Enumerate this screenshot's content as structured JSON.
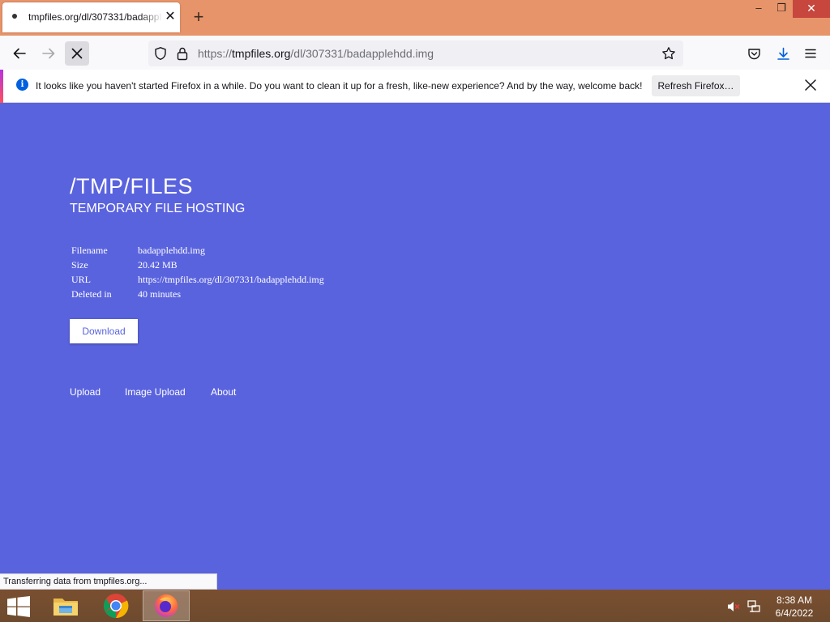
{
  "browser": {
    "tab": {
      "title": "tmpfiles.org/dl/307331/badapplehdd.img",
      "close_glyph": "✕"
    },
    "new_tab_glyph": "+",
    "window_controls": {
      "minimize": "–",
      "maximize": "❐",
      "close": "✕"
    },
    "url": {
      "prefix": "https://",
      "host": "tmpfiles.org",
      "path": "/dl/307331/badapplehdd.img"
    },
    "notification": {
      "message": "It looks like you haven't started Firefox in a while. Do you want to clean it up for a fresh, like-new experience? And by the way, welcome back!",
      "button_label": "Refresh Firefox…",
      "info_glyph": "i"
    },
    "status_text": "Transferring data from tmpfiles.org..."
  },
  "page": {
    "title": "/TMP/FILES",
    "subtitle": "TEMPORARY FILE HOSTING",
    "file_info": [
      {
        "label": "Filename",
        "value": "badapplehdd.img"
      },
      {
        "label": "Size",
        "value": "20.42 MB"
      },
      {
        "label": "URL",
        "value": "https://tmpfiles.org/dl/307331/badapplehdd.img"
      },
      {
        "label": "Deleted in",
        "value": "40 minutes"
      }
    ],
    "download_label": "Download",
    "footer_links": {
      "upload": "Upload",
      "image_upload": "Image Upload",
      "about": "About"
    }
  },
  "taskbar": {
    "time": "8:38 AM",
    "date": "6/4/2022",
    "apps": [
      "file-explorer-icon",
      "chrome-icon",
      "firefox-icon"
    ]
  },
  "colors": {
    "page_background": "#5a63de",
    "titlebar": "#e8946a",
    "taskbar": "#6d4a2e",
    "accent_blue": "#0060df"
  }
}
